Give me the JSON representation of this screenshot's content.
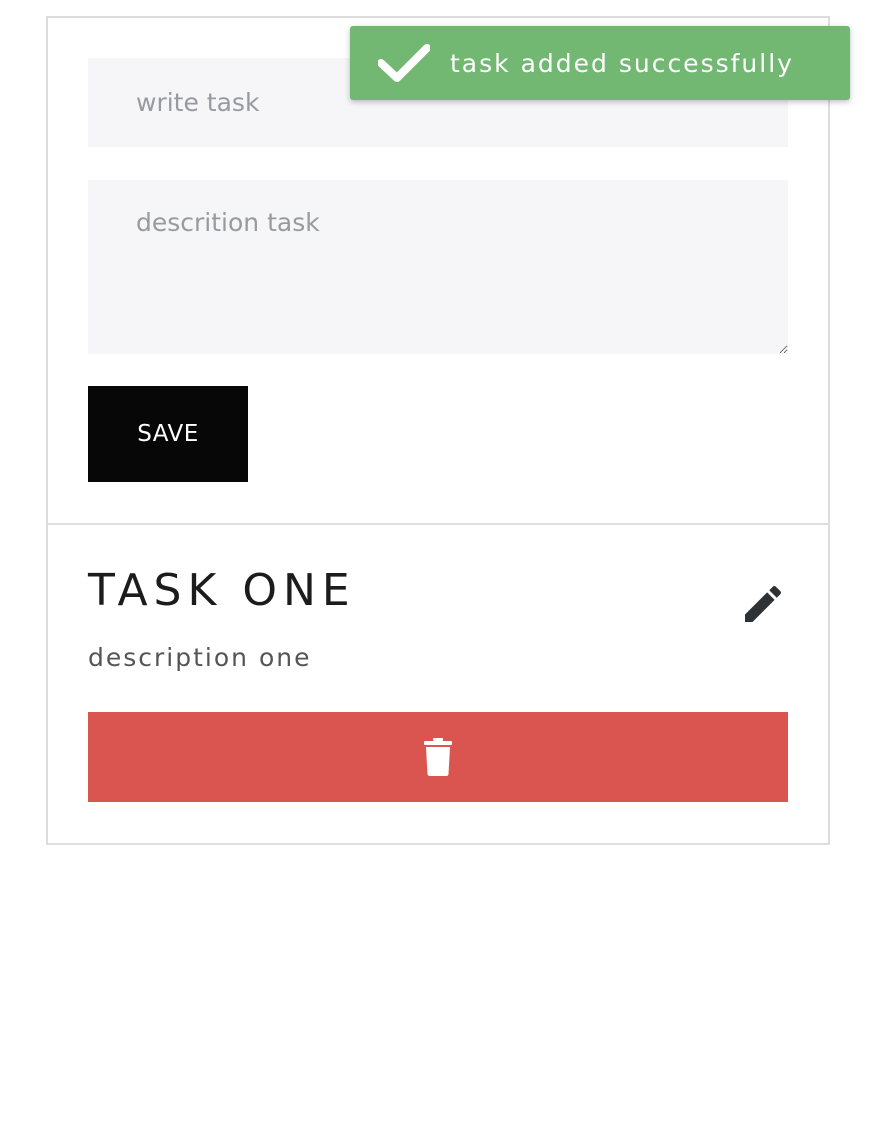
{
  "form": {
    "task_placeholder": "write task",
    "task_value": "",
    "description_placeholder": "descrition task",
    "description_value": "",
    "save_label": "SAVE"
  },
  "task": {
    "title": "TASK ONE",
    "description": "description one",
    "edit_icon": "pencil-icon",
    "delete_icon": "trash-icon"
  },
  "toast": {
    "message": "task added successfully",
    "icon": "checkmark-icon"
  },
  "colors": {
    "toast_bg": "#72b873",
    "delete_bg": "#da5450",
    "save_bg": "#070707",
    "input_bg": "#f6f6f8",
    "edit_icon": "#2f3235"
  }
}
